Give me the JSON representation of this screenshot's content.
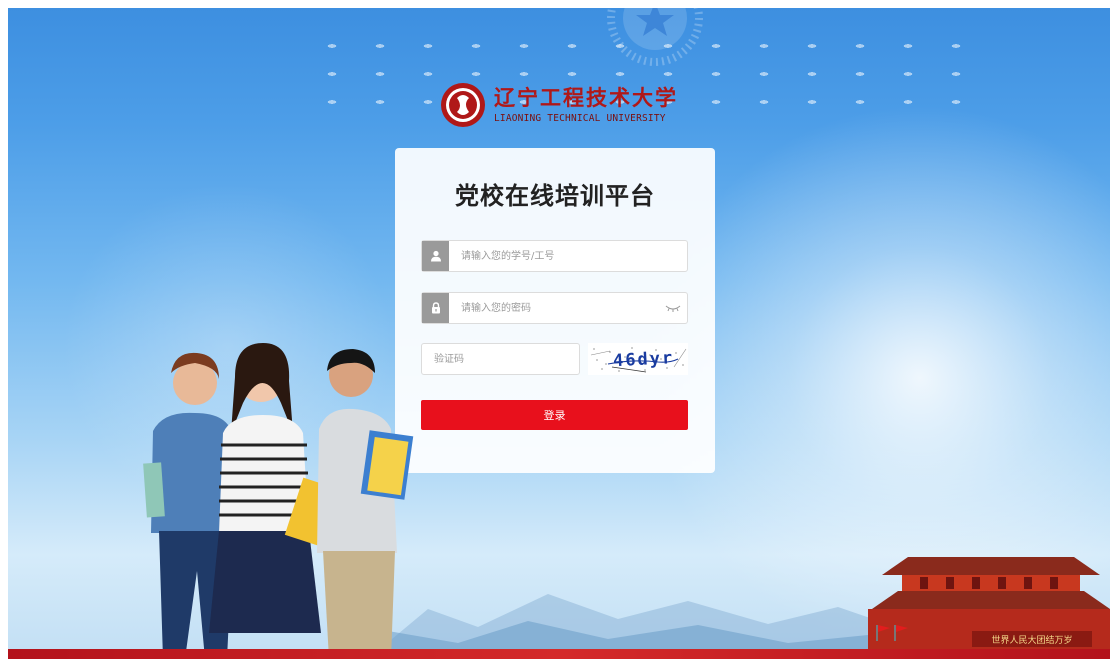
{
  "logo": {
    "name_cn": "辽宁工程技术大学",
    "name_en": "LIAONING TECHNICAL UNIVERSITY"
  },
  "login": {
    "title": "党校在线培训平台",
    "username_placeholder": "请输入您的学号/工号",
    "password_placeholder": "请输入您的密码",
    "captcha_placeholder": "验证码",
    "captcha_text": "46dyr",
    "submit_label": "登录"
  },
  "gate_plaque": "世界人民大团结万岁",
  "colors": {
    "accent_red": "#e8101c",
    "logo_red": "#b01818",
    "sky_blue": "#4d9ee8"
  }
}
